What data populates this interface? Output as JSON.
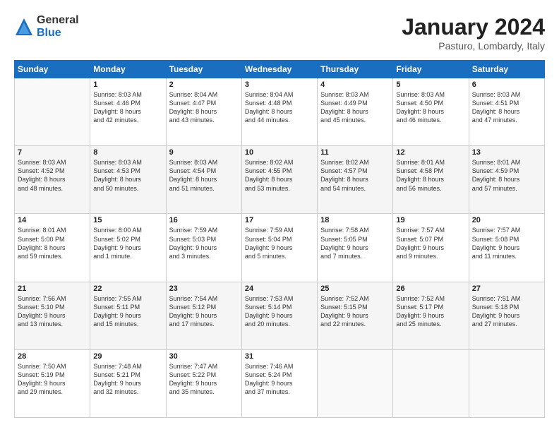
{
  "logo": {
    "general": "General",
    "blue": "Blue"
  },
  "header": {
    "title": "January 2024",
    "subtitle": "Pasturo, Lombardy, Italy"
  },
  "weekdays": [
    "Sunday",
    "Monday",
    "Tuesday",
    "Wednesday",
    "Thursday",
    "Friday",
    "Saturday"
  ],
  "weeks": [
    [
      {
        "day": "",
        "info": ""
      },
      {
        "day": "1",
        "info": "Sunrise: 8:03 AM\nSunset: 4:46 PM\nDaylight: 8 hours\nand 42 minutes."
      },
      {
        "day": "2",
        "info": "Sunrise: 8:04 AM\nSunset: 4:47 PM\nDaylight: 8 hours\nand 43 minutes."
      },
      {
        "day": "3",
        "info": "Sunrise: 8:04 AM\nSunset: 4:48 PM\nDaylight: 8 hours\nand 44 minutes."
      },
      {
        "day": "4",
        "info": "Sunrise: 8:03 AM\nSunset: 4:49 PM\nDaylight: 8 hours\nand 45 minutes."
      },
      {
        "day": "5",
        "info": "Sunrise: 8:03 AM\nSunset: 4:50 PM\nDaylight: 8 hours\nand 46 minutes."
      },
      {
        "day": "6",
        "info": "Sunrise: 8:03 AM\nSunset: 4:51 PM\nDaylight: 8 hours\nand 47 minutes."
      }
    ],
    [
      {
        "day": "7",
        "info": "Sunrise: 8:03 AM\nSunset: 4:52 PM\nDaylight: 8 hours\nand 48 minutes."
      },
      {
        "day": "8",
        "info": "Sunrise: 8:03 AM\nSunset: 4:53 PM\nDaylight: 8 hours\nand 50 minutes."
      },
      {
        "day": "9",
        "info": "Sunrise: 8:03 AM\nSunset: 4:54 PM\nDaylight: 8 hours\nand 51 minutes."
      },
      {
        "day": "10",
        "info": "Sunrise: 8:02 AM\nSunset: 4:55 PM\nDaylight: 8 hours\nand 53 minutes."
      },
      {
        "day": "11",
        "info": "Sunrise: 8:02 AM\nSunset: 4:57 PM\nDaylight: 8 hours\nand 54 minutes."
      },
      {
        "day": "12",
        "info": "Sunrise: 8:01 AM\nSunset: 4:58 PM\nDaylight: 8 hours\nand 56 minutes."
      },
      {
        "day": "13",
        "info": "Sunrise: 8:01 AM\nSunset: 4:59 PM\nDaylight: 8 hours\nand 57 minutes."
      }
    ],
    [
      {
        "day": "14",
        "info": "Sunrise: 8:01 AM\nSunset: 5:00 PM\nDaylight: 8 hours\nand 59 minutes."
      },
      {
        "day": "15",
        "info": "Sunrise: 8:00 AM\nSunset: 5:02 PM\nDaylight: 9 hours\nand 1 minute."
      },
      {
        "day": "16",
        "info": "Sunrise: 7:59 AM\nSunset: 5:03 PM\nDaylight: 9 hours\nand 3 minutes."
      },
      {
        "day": "17",
        "info": "Sunrise: 7:59 AM\nSunset: 5:04 PM\nDaylight: 9 hours\nand 5 minutes."
      },
      {
        "day": "18",
        "info": "Sunrise: 7:58 AM\nSunset: 5:05 PM\nDaylight: 9 hours\nand 7 minutes."
      },
      {
        "day": "19",
        "info": "Sunrise: 7:57 AM\nSunset: 5:07 PM\nDaylight: 9 hours\nand 9 minutes."
      },
      {
        "day": "20",
        "info": "Sunrise: 7:57 AM\nSunset: 5:08 PM\nDaylight: 9 hours\nand 11 minutes."
      }
    ],
    [
      {
        "day": "21",
        "info": "Sunrise: 7:56 AM\nSunset: 5:10 PM\nDaylight: 9 hours\nand 13 minutes."
      },
      {
        "day": "22",
        "info": "Sunrise: 7:55 AM\nSunset: 5:11 PM\nDaylight: 9 hours\nand 15 minutes."
      },
      {
        "day": "23",
        "info": "Sunrise: 7:54 AM\nSunset: 5:12 PM\nDaylight: 9 hours\nand 17 minutes."
      },
      {
        "day": "24",
        "info": "Sunrise: 7:53 AM\nSunset: 5:14 PM\nDaylight: 9 hours\nand 20 minutes."
      },
      {
        "day": "25",
        "info": "Sunrise: 7:52 AM\nSunset: 5:15 PM\nDaylight: 9 hours\nand 22 minutes."
      },
      {
        "day": "26",
        "info": "Sunrise: 7:52 AM\nSunset: 5:17 PM\nDaylight: 9 hours\nand 25 minutes."
      },
      {
        "day": "27",
        "info": "Sunrise: 7:51 AM\nSunset: 5:18 PM\nDaylight: 9 hours\nand 27 minutes."
      }
    ],
    [
      {
        "day": "28",
        "info": "Sunrise: 7:50 AM\nSunset: 5:19 PM\nDaylight: 9 hours\nand 29 minutes."
      },
      {
        "day": "29",
        "info": "Sunrise: 7:48 AM\nSunset: 5:21 PM\nDaylight: 9 hours\nand 32 minutes."
      },
      {
        "day": "30",
        "info": "Sunrise: 7:47 AM\nSunset: 5:22 PM\nDaylight: 9 hours\nand 35 minutes."
      },
      {
        "day": "31",
        "info": "Sunrise: 7:46 AM\nSunset: 5:24 PM\nDaylight: 9 hours\nand 37 minutes."
      },
      {
        "day": "",
        "info": ""
      },
      {
        "day": "",
        "info": ""
      },
      {
        "day": "",
        "info": ""
      }
    ]
  ]
}
